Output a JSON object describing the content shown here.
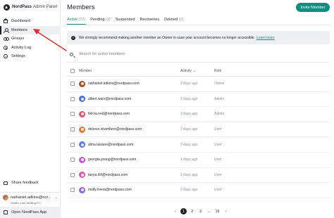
{
  "brand": {
    "name": "NordPass",
    "subtitle": "Admin Panel"
  },
  "sidebar": {
    "items": [
      {
        "label": "Dashboard",
        "icon": "home-icon"
      },
      {
        "label": "Members",
        "icon": "user-icon"
      },
      {
        "label": "Groups",
        "icon": "group-icon"
      },
      {
        "label": "Activity Log",
        "icon": "activity-icon"
      },
      {
        "label": "Settings",
        "icon": "gear-icon"
      }
    ],
    "active_index": 1,
    "feedback_label": "Share feedback",
    "account": {
      "name": "nathaniel.adkins@nor...",
      "org": "Health Care Staffing P.C."
    },
    "open_app_label": "Open NordPass App"
  },
  "main": {
    "title": "Members",
    "invite_label": "Invite Member",
    "tabs": [
      {
        "label": "Active",
        "count": "(27)"
      },
      {
        "label": "Pending",
        "count": "(2)"
      },
      {
        "label": "Suspended",
        "count": ""
      },
      {
        "label": "Recoveries",
        "count": ""
      },
      {
        "label": "Deleted",
        "count": "(2)"
      }
    ],
    "banner": {
      "text": "We strongly recommend making another member an Owner in case your account becomes no longer accessible.",
      "link": "Learn more"
    },
    "search": {
      "placeholder": "Search for active members"
    },
    "table": {
      "headers": {
        "member": "Member",
        "activity": "Activity",
        "role": "Role"
      },
      "rows": [
        {
          "email": "nathaniel.adkins@nordpass.com",
          "activity": "2 days ago",
          "role": "Owner",
          "avatar_color": "#a0522d"
        },
        {
          "email": "albert.ware@nordpass.com",
          "activity": "2 days ago",
          "role": "Admin",
          "avatar_color": "#4a6ee0"
        },
        {
          "email": "felicia.reid@nordpass.com",
          "activity": "2 days ago",
          "role": "Admin",
          "avatar_color": "#e0566a"
        },
        {
          "email": "dolores.chambers@nordpass.com",
          "activity": "2 days ago",
          "role": "User",
          "avatar_color": "#e07a3a"
        },
        {
          "email": "alma.lawson@nordpass.com",
          "activity": "2 days ago",
          "role": "User",
          "avatar_color": "#5b7be0"
        },
        {
          "email": "georgia.young@nordpass.com",
          "activity": "2 days ago",
          "role": "User",
          "avatar_color": "#b95ad6"
        },
        {
          "email": "tanya.hill@nordpass.com",
          "activity": "2 days ago",
          "role": "User",
          "avatar_color": "#e05aa0"
        },
        {
          "email": "molly.rivera@nordpass.com",
          "activity": "2 days ago",
          "role": "User",
          "avatar_color": "#8a6ae0"
        }
      ]
    },
    "pagination": {
      "prev": "‹",
      "pages": [
        "1",
        "2",
        "3",
        "...",
        "15"
      ],
      "current": "1",
      "next": "›"
    }
  },
  "colors": {
    "accent": "#0f8f82",
    "annotation_arrow": "#e0302f"
  }
}
